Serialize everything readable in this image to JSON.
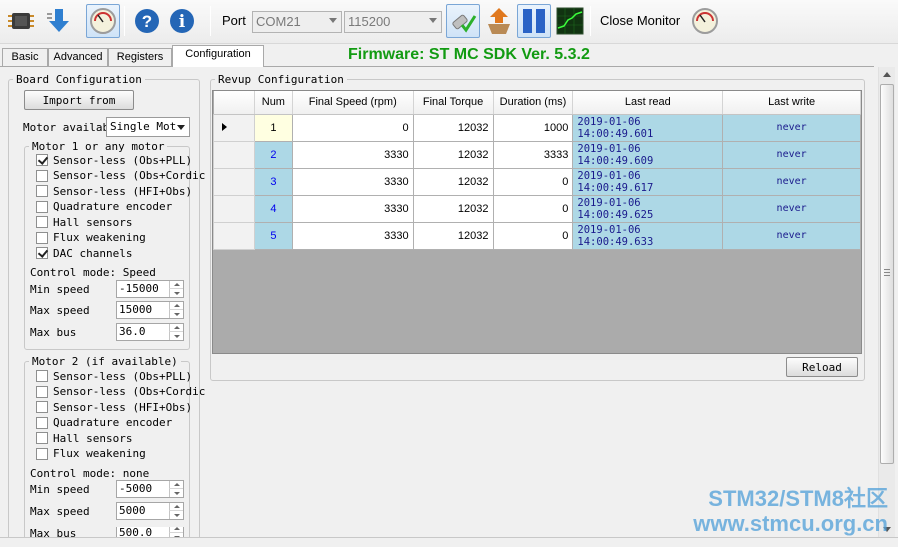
{
  "toolbar": {
    "port_label": "Port",
    "port_value": "COM21",
    "baud_value": "115200",
    "close_monitor_label": "Close Monitor"
  },
  "tabs": [
    "Basic",
    "Advanced",
    "Registers",
    "Configuration"
  ],
  "active_tab": "Configuration",
  "firmware": "Firmware: ST MC SDK Ver. 5.3.2",
  "board": {
    "legend": "Board Configuration",
    "import_button": "Import from",
    "motor_available_label": "Motor availabl",
    "motor_available_value": "Single Mot",
    "motor1": {
      "legend": "Motor 1 or any motor",
      "options": [
        {
          "label": "Sensor-less (Obs+PLL)",
          "checked": true
        },
        {
          "label": "Sensor-less (Obs+Cordic",
          "checked": false
        },
        {
          "label": "Sensor-less (HFI+Obs)",
          "checked": false
        },
        {
          "label": "Quadrature encoder",
          "checked": false
        },
        {
          "label": "Hall sensors",
          "checked": false
        },
        {
          "label": "Flux weakening",
          "checked": false
        },
        {
          "label": "DAC channels",
          "checked": true
        }
      ],
      "control_mode": "Control mode: Speed",
      "min_speed_label": "Min speed",
      "min_speed": "-15000",
      "max_speed_label": "Max speed",
      "max_speed": "15000",
      "max_bus_label": "Max bus",
      "max_bus": "36.0"
    },
    "motor2": {
      "legend": "Motor 2 (if available)",
      "options": [
        {
          "label": "Sensor-less (Obs+PLL)",
          "checked": false
        },
        {
          "label": "Sensor-less (Obs+Cordic",
          "checked": false
        },
        {
          "label": "Sensor-less (HFI+Obs)",
          "checked": false
        },
        {
          "label": "Quadrature encoder",
          "checked": false
        },
        {
          "label": "Hall sensors",
          "checked": false
        },
        {
          "label": "Flux weakening",
          "checked": false
        }
      ],
      "control_mode": "Control mode: none",
      "min_speed_label": "Min speed",
      "min_speed": "-5000",
      "max_speed_label": "Max speed",
      "max_speed": "5000",
      "max_bus_label": "Max bus",
      "max_bus": "500.0"
    }
  },
  "revup": {
    "legend": "Revup Configuration",
    "columns": [
      "Num",
      "Final Speed (rpm)",
      "Final Torque",
      "Duration (ms)",
      "Last read",
      "Last write"
    ],
    "rows": [
      {
        "num": "1",
        "speed": "0",
        "torque": "12032",
        "duration": "1000",
        "last_read": "2019-01-06 14:00:49.601",
        "last_write": "never"
      },
      {
        "num": "2",
        "speed": "3330",
        "torque": "12032",
        "duration": "3333",
        "last_read": "2019-01-06 14:00:49.609",
        "last_write": "never"
      },
      {
        "num": "3",
        "speed": "3330",
        "torque": "12032",
        "duration": "0",
        "last_read": "2019-01-06 14:00:49.617",
        "last_write": "never"
      },
      {
        "num": "4",
        "speed": "3330",
        "torque": "12032",
        "duration": "0",
        "last_read": "2019-01-06 14:00:49.625",
        "last_write": "never"
      },
      {
        "num": "5",
        "speed": "3330",
        "torque": "12032",
        "duration": "0",
        "last_read": "2019-01-06 14:00:49.633",
        "last_write": "never"
      }
    ],
    "reload_button": "Reload"
  },
  "watermark": {
    "line1": "STM32/STM8社区",
    "line2": "www.stmcu.org.cn"
  },
  "colors": {
    "firmware": "#129b12",
    "grid_background": "#ababab",
    "cell_highlight": "#add8e6",
    "watermark": "#4f9fd8"
  },
  "icons": [
    "chip-icon",
    "download-arrow-icon",
    "gauge-icon",
    "help-icon",
    "info-icon",
    "connect-plug-icon",
    "upload-box-icon",
    "pause-icon",
    "oscilloscope-icon",
    "gauge-icon"
  ]
}
